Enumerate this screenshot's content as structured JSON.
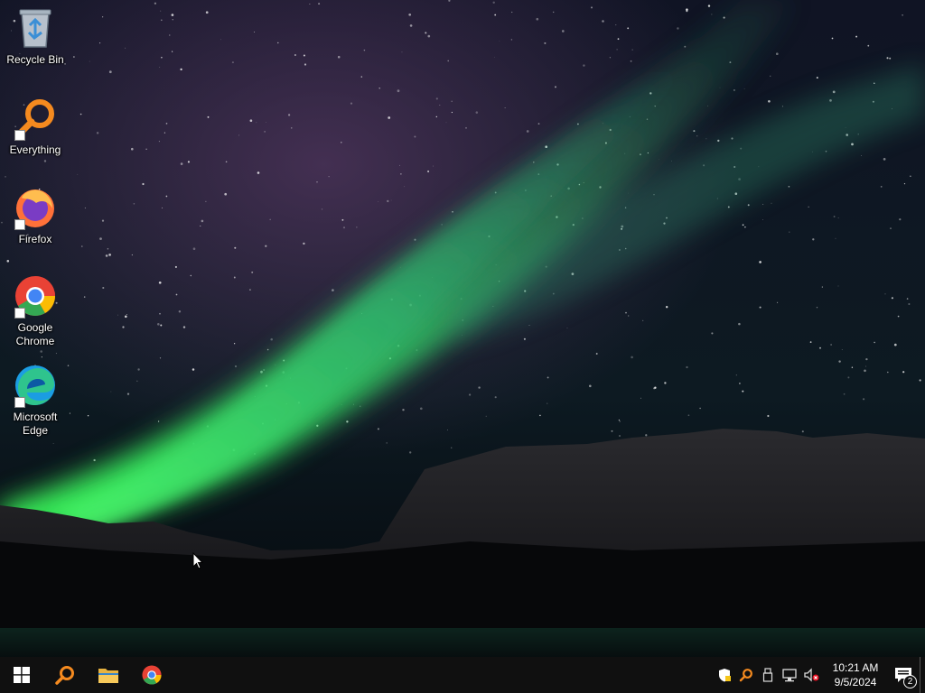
{
  "desktop": {
    "icons": [
      {
        "label": "Recycle Bin",
        "icon": "recycle-bin-icon"
      },
      {
        "label": "Everything",
        "icon": "everything-search-icon"
      },
      {
        "label": "Firefox",
        "icon": "firefox-icon"
      },
      {
        "label": "Google\nChrome",
        "icon": "chrome-icon"
      },
      {
        "label": "Microsoft\nEdge",
        "icon": "edge-icon"
      }
    ]
  },
  "taskbar": {
    "pinned": [
      {
        "name": "start",
        "icon": "windows-logo-icon"
      },
      {
        "name": "everything",
        "icon": "everything-search-icon"
      },
      {
        "name": "file-explorer",
        "icon": "folder-icon"
      },
      {
        "name": "chrome",
        "icon": "chrome-icon"
      }
    ],
    "tray": {
      "icons": [
        "security-shield-icon",
        "everything-search-icon",
        "usb-device-icon",
        "network-icon",
        "volume-muted-icon"
      ],
      "time": "10:21 AM",
      "date": "9/5/2024",
      "notification_count": "2"
    }
  },
  "colors": {
    "taskbar": "#101010",
    "aurora_green": "#3ee06a",
    "aurora_purple": "#7a3f7a",
    "sky": "#0b1020"
  }
}
